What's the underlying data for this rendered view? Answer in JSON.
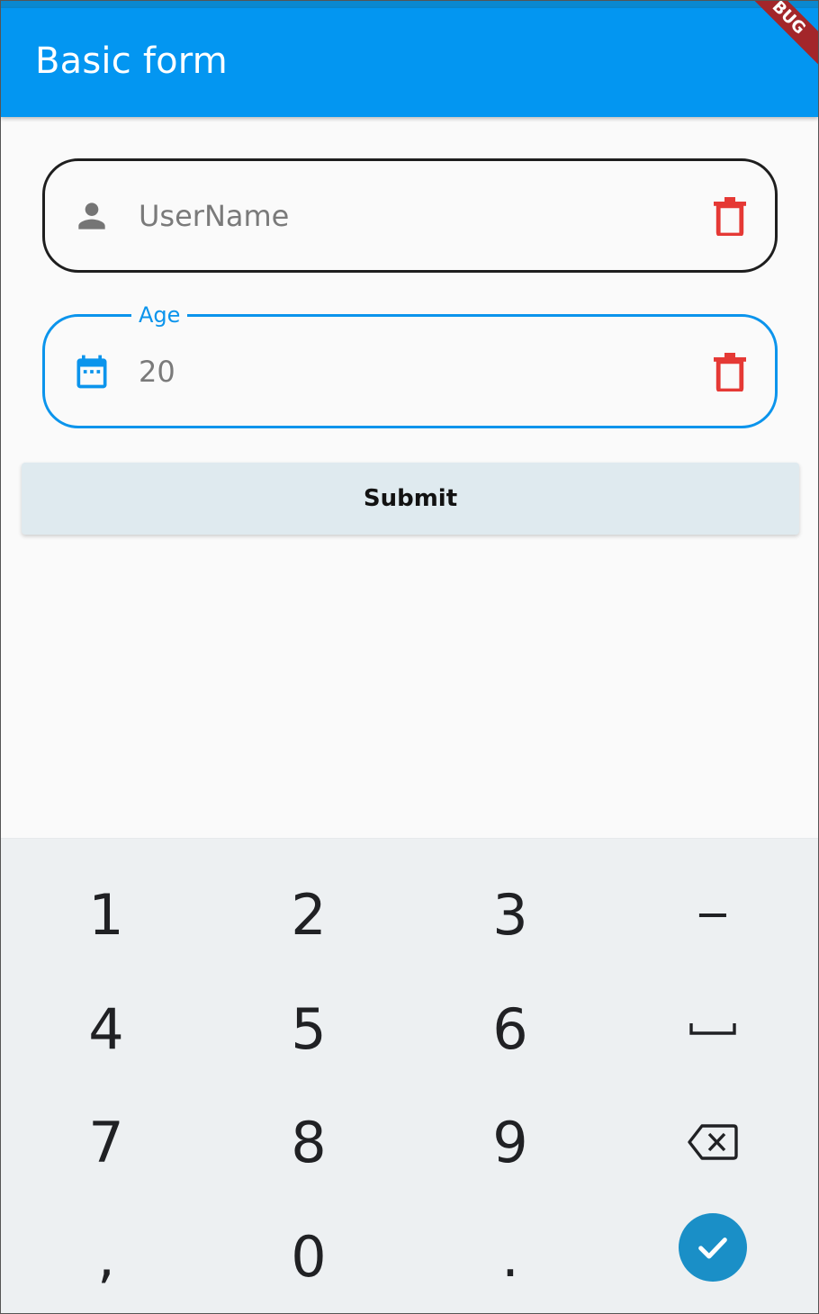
{
  "appbar": {
    "title": "Basic form",
    "debug_banner": "BUG",
    "color": "#0396f1"
  },
  "form": {
    "username": {
      "placeholder": "UserName",
      "icon": "person-icon",
      "delete_icon": "trash-icon"
    },
    "age": {
      "label": "Age",
      "value": "20",
      "icon": "calendar-icon",
      "delete_icon": "trash-icon"
    },
    "submit_label": "Submit"
  },
  "keyboard": {
    "rows": [
      [
        "1",
        "2",
        "3",
        "−"
      ],
      [
        "4",
        "5",
        "6",
        "space"
      ],
      [
        "7",
        "8",
        "9",
        "backspace"
      ],
      [
        ",",
        "0",
        ".",
        "enter"
      ]
    ],
    "enter_color": "#1a8fc7"
  },
  "colors": {
    "accent": "#0b94ec",
    "delete": "#e53935",
    "icon_grey": "#757575"
  }
}
